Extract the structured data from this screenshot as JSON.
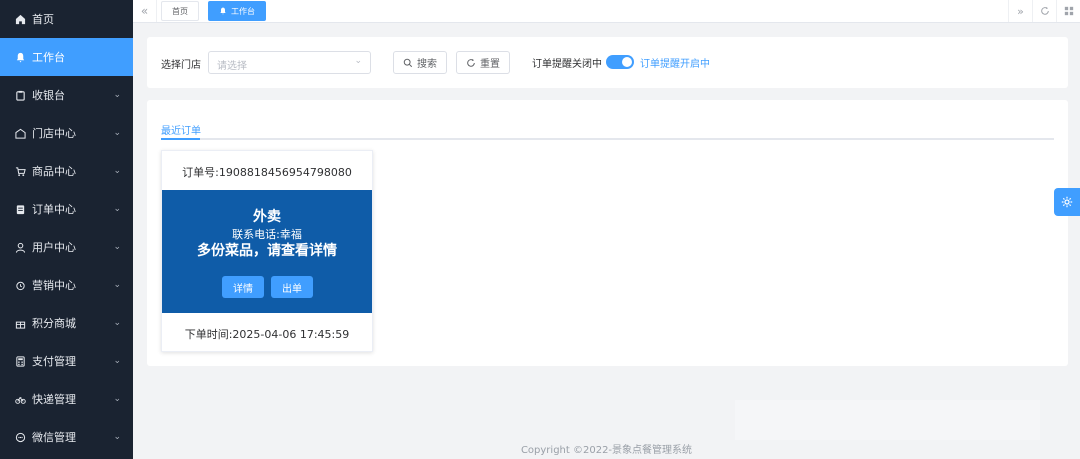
{
  "sidebar": {
    "items": [
      {
        "label": "首页",
        "icon": "home-icon",
        "has_chevron": false,
        "active": false
      },
      {
        "label": "工作台",
        "icon": "bell-icon",
        "has_chevron": false,
        "active": true
      },
      {
        "label": "收银台",
        "icon": "clipboard-icon",
        "has_chevron": true,
        "active": false
      },
      {
        "label": "门店中心",
        "icon": "store-icon",
        "has_chevron": true,
        "active": false
      },
      {
        "label": "商品中心",
        "icon": "cart-icon",
        "has_chevron": true,
        "active": false
      },
      {
        "label": "订单中心",
        "icon": "order-icon",
        "has_chevron": true,
        "active": false
      },
      {
        "label": "用户中心",
        "icon": "user-icon",
        "has_chevron": true,
        "active": false
      },
      {
        "label": "营销中心",
        "icon": "alarm-icon",
        "has_chevron": true,
        "active": false
      },
      {
        "label": "积分商城",
        "icon": "gift-icon",
        "has_chevron": true,
        "active": false
      },
      {
        "label": "支付管理",
        "icon": "calculator-icon",
        "has_chevron": true,
        "active": false
      },
      {
        "label": "快递管理",
        "icon": "bicycle-icon",
        "has_chevron": true,
        "active": false
      },
      {
        "label": "微信管理",
        "icon": "chat-icon",
        "has_chevron": true,
        "active": false
      }
    ]
  },
  "tabs": [
    {
      "label": "首页",
      "active": false
    },
    {
      "label": "工作台",
      "active": true
    }
  ],
  "filter": {
    "store_label": "选择门店",
    "store_placeholder": "请选择",
    "search_label": "搜索",
    "reset_label": "重置",
    "reminder_off_label": "订单提醒关闭中",
    "reminder_on_label": "订单提醒开启中",
    "reminder_on": true
  },
  "orders_panel": {
    "tab_label": "最近订单",
    "orders": [
      {
        "order_no": "订单号:1908818456954798080",
        "type": "外卖",
        "contact": "联系电话:幸福",
        "message": "多份菜品，请查看详情",
        "detail_label": "详情",
        "ship_label": "出单",
        "time": "下单时间:2025-04-06 17:45:59"
      }
    ]
  },
  "footer": {
    "copyright": "Copyright ©2022-景象点餐管理系统"
  },
  "colors": {
    "sidebar_bg": "#1a2331",
    "accent": "#409eff",
    "order_card_bg": "#0f5ca8"
  }
}
